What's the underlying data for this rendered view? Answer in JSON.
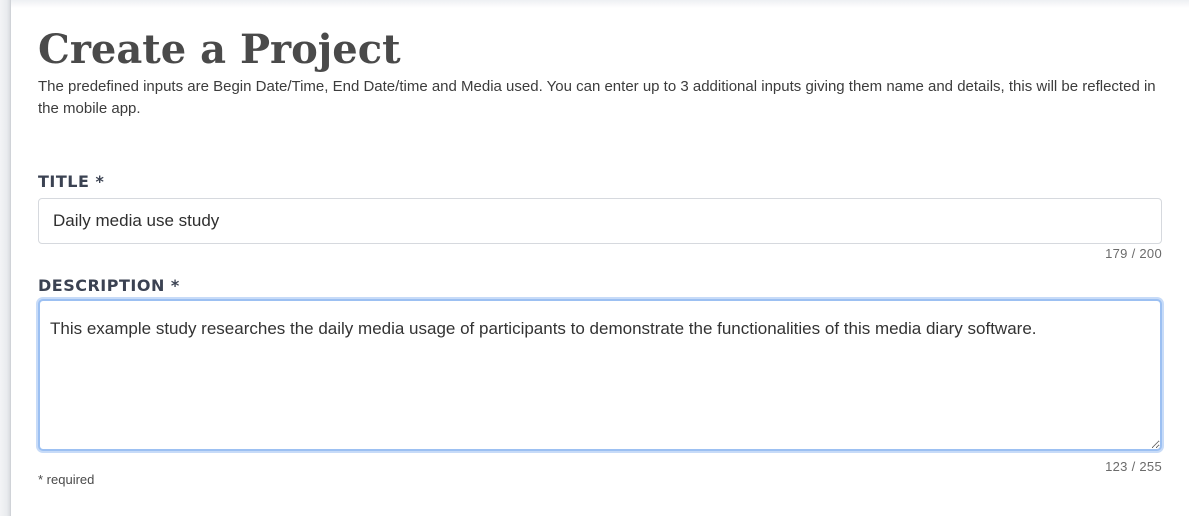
{
  "page": {
    "title": "Create a Project",
    "intro": "The predefined inputs are Begin Date/Time, End Date/time and Media used. You can enter up to 3 additional inputs giving them name and details, this will be reflected in the mobile app."
  },
  "form": {
    "title_field": {
      "label": "TITLE *",
      "value": "Daily media use study",
      "counter": "179 / 200"
    },
    "description_field": {
      "label": "DESCRIPTION *",
      "value": "This example study researches the daily media usage of participants to demonstrate the functionalities of this media diary software.",
      "counter": "123 / 255"
    },
    "required_note": "* required"
  },
  "colors": {
    "focus_border": "#9cc0f2",
    "heading": "#4a4a4a",
    "label": "#3b4252"
  }
}
